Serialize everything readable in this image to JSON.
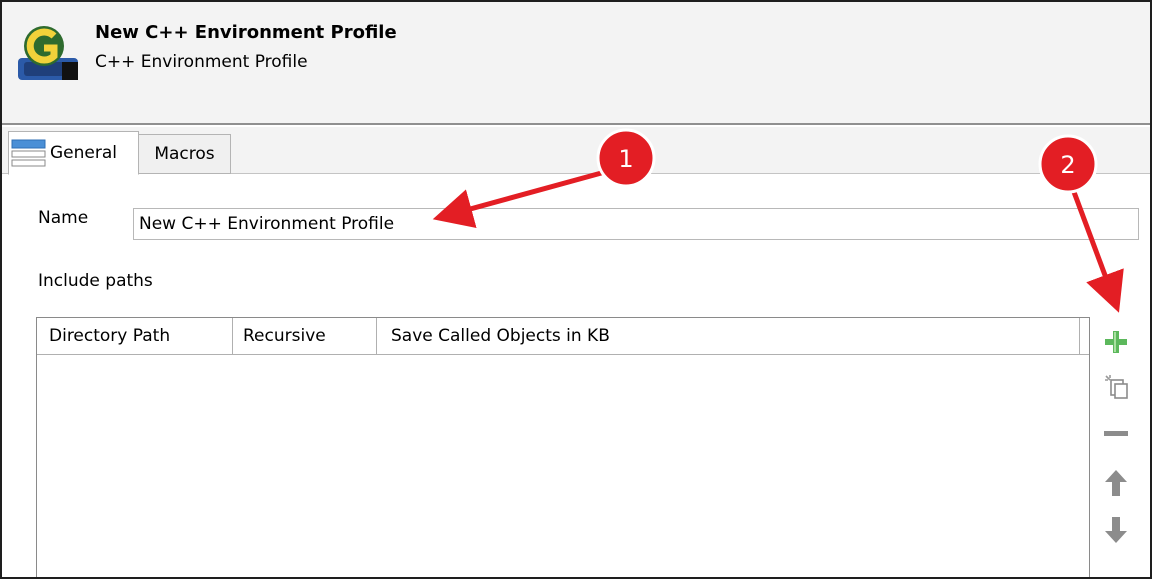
{
  "header": {
    "title": "New C++ Environment Profile",
    "subtitle": "C++ Environment Profile",
    "icon": "c-environment-icon"
  },
  "tabs": [
    {
      "label": "General",
      "icon": "form-icon",
      "active": true
    },
    {
      "label": "Macros",
      "active": false
    }
  ],
  "form": {
    "name_label": "Name",
    "name_value": "New C++ Environment Profile",
    "include_label": "Include paths"
  },
  "table": {
    "columns": [
      "Directory Path",
      "Recursive",
      "Save Called Objects in KB"
    ],
    "rows": []
  },
  "toolbar": {
    "add_icon": "plus-icon",
    "copy_icon": "copy-icon",
    "remove_icon": "minus-icon",
    "up_icon": "arrow-up-icon",
    "down_icon": "arrow-down-icon"
  },
  "annotations": [
    {
      "number": "1"
    },
    {
      "number": "2"
    }
  ],
  "colors": {
    "callout_red": "#e31e24",
    "add_green": "#5cb85c",
    "disabled_gray": "#8c8c8c"
  }
}
